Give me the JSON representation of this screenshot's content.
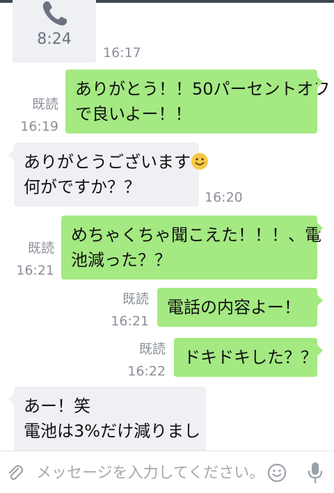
{
  "messages": [
    {
      "kind": "call",
      "side": "in",
      "duration": "8:24",
      "time": "16:17"
    },
    {
      "side": "out",
      "lines": [
        "ありがとう！！50パーセントオフ",
        "で良いよー！！"
      ],
      "read": "既読",
      "time": "16:19"
    },
    {
      "side": "in",
      "lines": [
        "ありがとうございます",
        "何がですか？？"
      ],
      "emoji": "smiling-face-icon",
      "time": "16:20"
    },
    {
      "side": "out",
      "lines": [
        "めちゃくちゃ聞こえた！！！、電",
        "池減った？？"
      ],
      "read": "既読",
      "time": "16:21"
    },
    {
      "side": "out",
      "lines": [
        "電話の内容よー！"
      ],
      "read": "既読",
      "time": "16:21"
    },
    {
      "side": "out",
      "lines": [
        "ドキドキした？？"
      ],
      "read": "既読",
      "time": "16:22"
    },
    {
      "side": "in",
      "lines": [
        "あー！笑",
        "電池は3%だけ減りまし"
      ],
      "time": ""
    }
  ],
  "composer": {
    "placeholder": "メッセージを入力してください。",
    "icons": [
      "paperclip-icon",
      "emoji-icon",
      "microphone-icon"
    ]
  },
  "colors": {
    "outgoing_bubble": "#a4e982",
    "incoming_bubble": "#eef0f3",
    "meta_text": "#8a8f98"
  }
}
